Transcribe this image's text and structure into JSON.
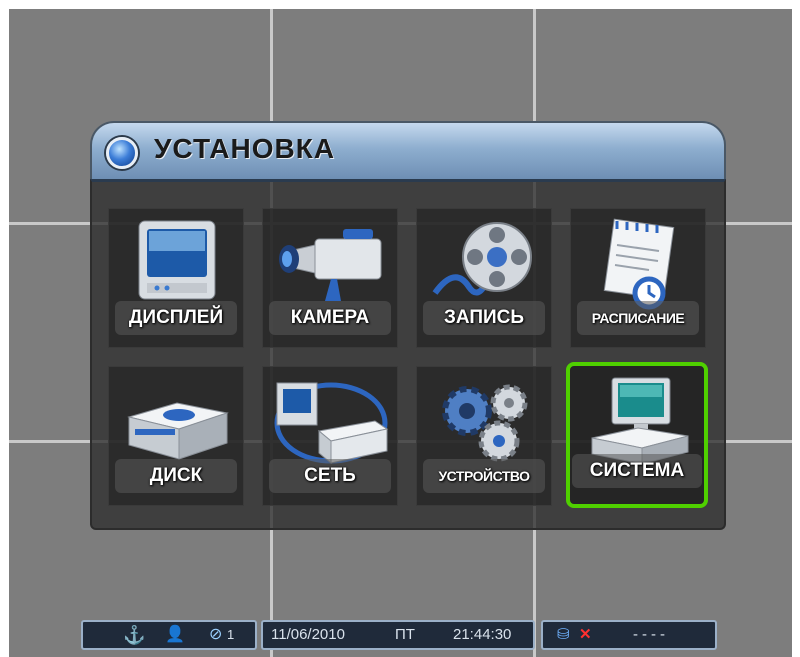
{
  "window": {
    "title": "УСТАНОВКА",
    "icon": "blue-orb-icon"
  },
  "menu": {
    "items": [
      {
        "label": "ДИСПЛЕЙ",
        "icon": "monitor-icon",
        "selected": false
      },
      {
        "label": "КАМЕРА",
        "icon": "camera-icon",
        "selected": false
      },
      {
        "label": "ЗАПИСЬ",
        "icon": "film-reel-icon",
        "selected": false
      },
      {
        "label": "РАСПИСАНИЕ",
        "icon": "schedule-clock-icon",
        "selected": false
      },
      {
        "label": "ДИСК",
        "icon": "disk-drive-icon",
        "selected": false
      },
      {
        "label": "СЕТЬ",
        "icon": "network-icon",
        "selected": false
      },
      {
        "label": "УСТРОЙСТВО",
        "icon": "gears-icon",
        "selected": false
      },
      {
        "label": "СИСТЕМА",
        "icon": "computer-icon",
        "selected": true
      }
    ],
    "selection_color": "#4fd000"
  },
  "status": {
    "channel_number": "1",
    "date": "11/06/2010",
    "weekday": "ПТ",
    "time": "21:44:30",
    "disk_status": "----",
    "icons": [
      "usb-icon",
      "user-icon",
      "link-icon",
      "database-icon",
      "error-x-icon"
    ]
  },
  "colors": {
    "background": "#7d7d7d",
    "titlebar": "#8eaecf",
    "status_background": "#1f2a3a"
  }
}
